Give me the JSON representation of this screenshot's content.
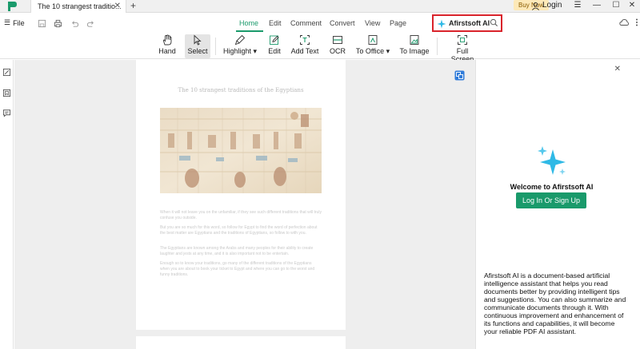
{
  "titlebar": {
    "tab_title": "The 10 strangest traditio...",
    "tab_close": "✕",
    "new_tab": "+",
    "buy_now": "Buy Now",
    "login": "Login",
    "menu_glyph": "☰",
    "minimize_glyph": "—",
    "maximize_glyph": "☐",
    "close_glyph": "✕"
  },
  "menubar": {
    "file_label": "File",
    "file_glyph": "☰",
    "tabs": [
      "Home",
      "Edit",
      "Comment",
      "Convert",
      "View",
      "Page"
    ],
    "active_tab": "Home",
    "search_label": "Afirstsoft AI"
  },
  "toolbar": {
    "tools": [
      {
        "label": "Hand",
        "icon": "hand-icon"
      },
      {
        "label": "Select",
        "icon": "cursor-icon"
      },
      {
        "label": "Highlight ▾",
        "icon": "highlighter-icon"
      },
      {
        "label": "Edit",
        "icon": "edit-icon"
      },
      {
        "label": "Add Text",
        "icon": "add-text-icon"
      },
      {
        "label": "OCR",
        "icon": "ocr-icon"
      },
      {
        "label": "To Office ▾",
        "icon": "to-office-icon"
      },
      {
        "label": "To Image",
        "icon": "to-image-icon"
      },
      {
        "label": "Full Screen",
        "icon": "full-screen-icon"
      }
    ],
    "selected_tool": "Select"
  },
  "document": {
    "title": "The 10 strangest traditions of the Egyptians",
    "paragraphs": [
      "When it will not leave you on the unfamiliar, if they see such different traditions that will truly confuse you outside.",
      "But you are so much for this word, so follow for Egypt to find the word of perfection about the best matter are Egyptians and the traditions of Egyptians, so follow to with you.",
      "The Egyptians are known among the Arabs and many peoples for their ability to create laughter and jests at any time, and it is also important not to be entertain.",
      "Enough so to know your traditions, go many of the different traditions of the Egyptians when you are about to book your ticket to Egypt and where you can go to the worst and funny traditions."
    ]
  },
  "ai_panel": {
    "close_glyph": "✕",
    "welcome": "Welcome to Afirstsoft AI",
    "login_button": "Log In Or Sign Up",
    "description": "Afirstsoft AI is a document-based artificial intelligence assistant that helps you read documents better by providing intelligent tips and suggestions. You can also summarize and communicate documents through it. With continuous improvement and enhancement of its functions and capabilities, it will become your reliable PDF AI assistant."
  },
  "colors": {
    "accent": "#1a9a6b",
    "highlight_border": "#d9232b",
    "ai_sparkle": "#2fb9e6"
  }
}
